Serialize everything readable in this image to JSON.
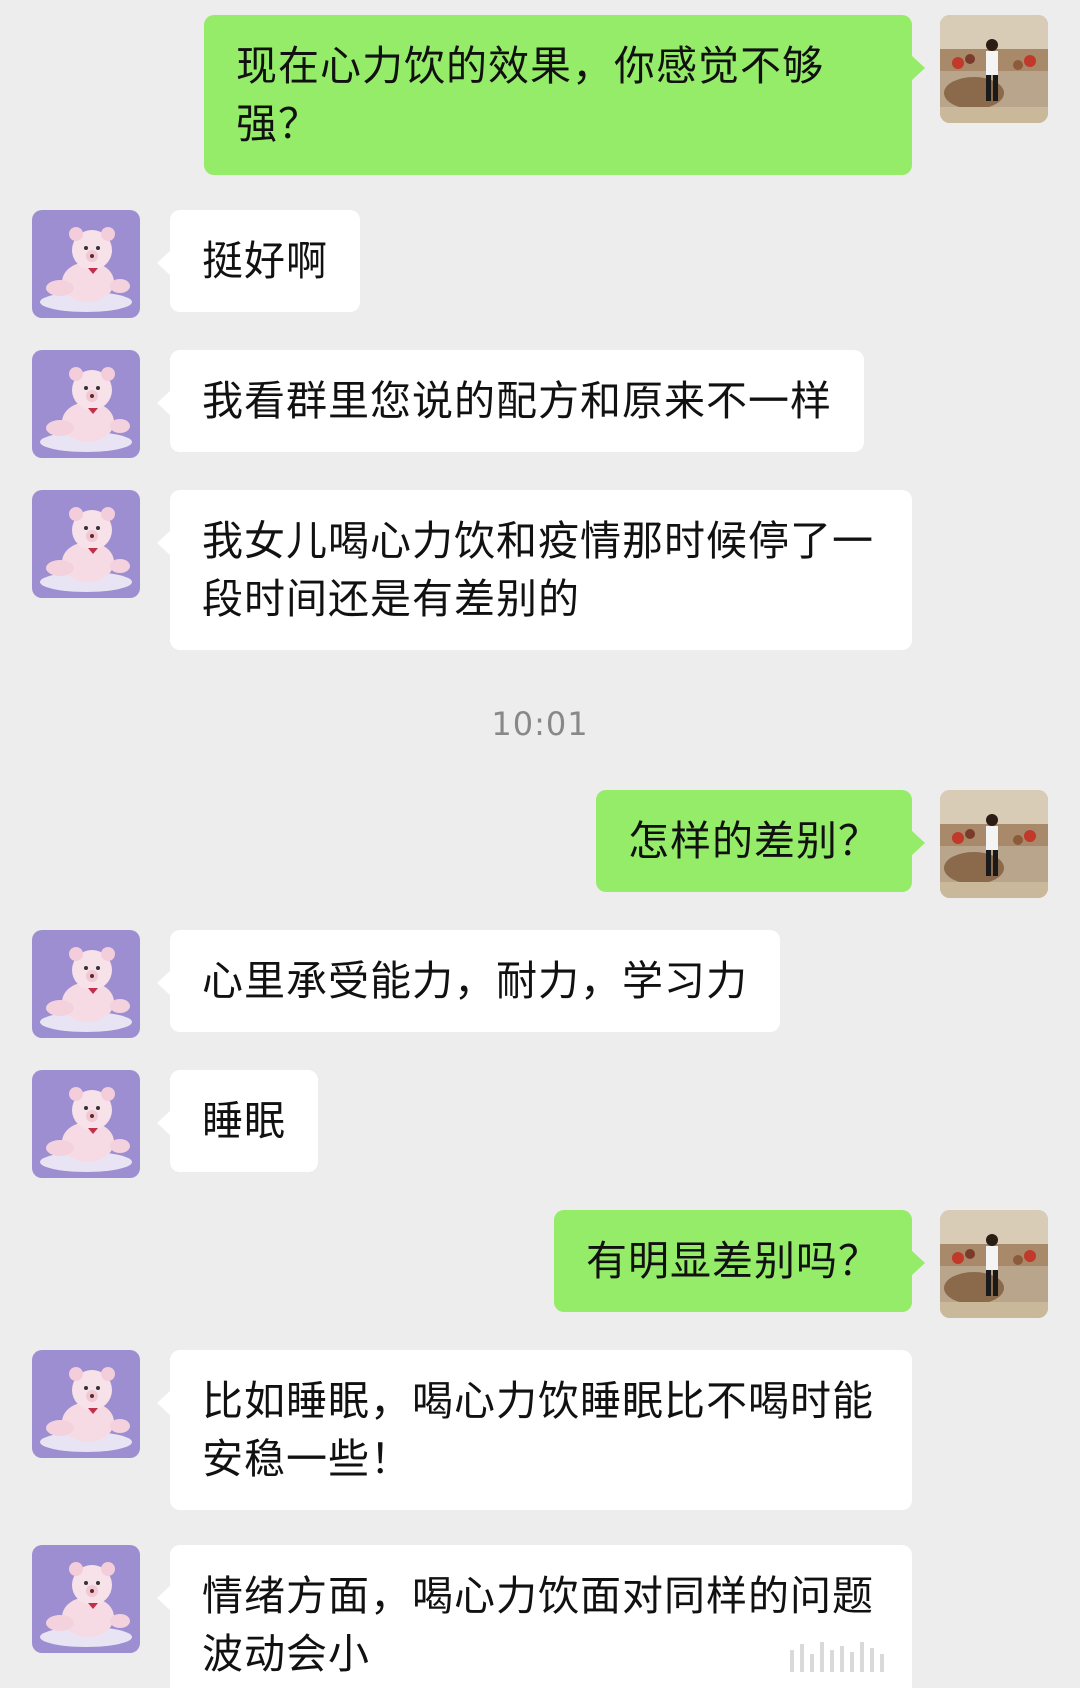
{
  "chat": {
    "messages": [
      {
        "side": "out",
        "avatar": "desert-photo-avatar",
        "text": "现在心力饮的效果，你感觉不够强？"
      },
      {
        "side": "in",
        "avatar": "teddy-bear-avatar",
        "text": "挺好啊"
      },
      {
        "side": "in",
        "avatar": "teddy-bear-avatar",
        "text": "我看群里您说的配方和原来不一样"
      },
      {
        "side": "in",
        "avatar": "teddy-bear-avatar",
        "text": "我女儿喝心力饮和疫情那时候停了一段时间还是有差别的"
      },
      {
        "side": "out",
        "avatar": "desert-photo-avatar",
        "text": "怎样的差别？"
      },
      {
        "side": "in",
        "avatar": "teddy-bear-avatar",
        "text": "心里承受能力，耐力，学习力"
      },
      {
        "side": "in",
        "avatar": "teddy-bear-avatar",
        "text": "睡眠"
      },
      {
        "side": "out",
        "avatar": "desert-photo-avatar",
        "text": "有明显差别吗？"
      },
      {
        "side": "in",
        "avatar": "teddy-bear-avatar",
        "text": "比如睡眠，喝心力饮睡眠比不喝时能安稳一些！"
      },
      {
        "side": "in",
        "avatar": "teddy-bear-avatar",
        "text": "情绪方面，喝心力饮面对同样的问题波动会小"
      }
    ],
    "timestamp": "10:01"
  },
  "colors": {
    "background": "#ededed",
    "incoming_bubble": "#ffffff",
    "outgoing_bubble": "#95ec69",
    "timestamp": "#888888"
  }
}
